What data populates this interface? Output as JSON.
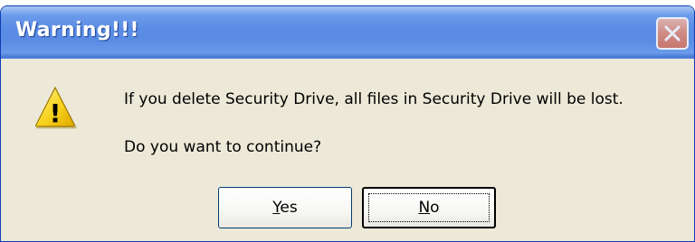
{
  "window": {
    "title": "Warning!!!",
    "close_icon": "close-icon"
  },
  "icon": {
    "name": "warning-icon",
    "glyph": "!",
    "fill_color": "#f7d21c"
  },
  "message": {
    "line1": "If you delete Security Drive, all files in Security Drive will be lost.",
    "line2": "Do you want to continue?"
  },
  "buttons": {
    "yes": {
      "label": "Yes",
      "accesskey": "Y"
    },
    "no": {
      "label": "No",
      "accesskey": "N",
      "focused": true
    }
  },
  "colors": {
    "titlebar": "#5a8ce4",
    "dialog_bg": "#ece9d8",
    "close_button": "#e58b73"
  }
}
